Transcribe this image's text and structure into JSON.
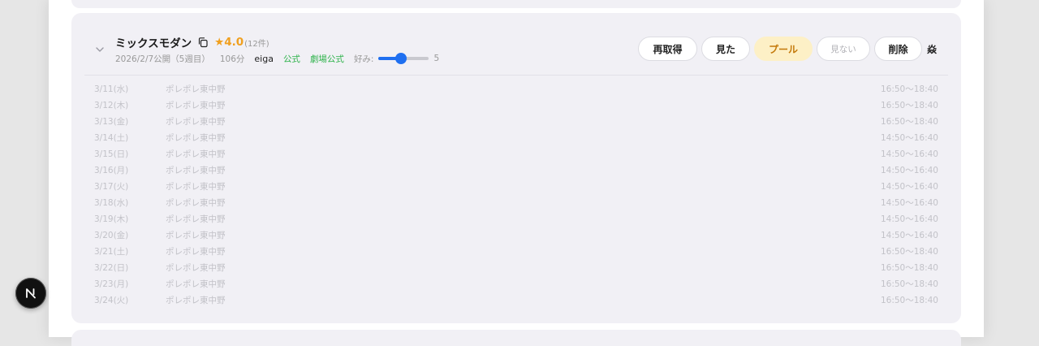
{
  "movie": {
    "title": "ミックスモダン",
    "rating": "★4.0",
    "rating_count": "(12件)",
    "release": "2026/2/7公開（5週目）",
    "runtime": "106分",
    "source": "eiga",
    "tag_official": "公式",
    "tag_theater_official": "劇場公式",
    "preference_label": "好み:",
    "preference_value": "5",
    "preference_fraction": 0.45
  },
  "actions": {
    "refetch": "再取得",
    "watched": "見た",
    "pool": "プール",
    "not_watching": "見ない",
    "delete": "削除",
    "overflow": "焱"
  },
  "showtimes": [
    {
      "date": "3/11(水)",
      "venue": "ポレポレ東中野",
      "time": "16:50〜18:40"
    },
    {
      "date": "3/12(木)",
      "venue": "ポレポレ東中野",
      "time": "16:50〜18:40"
    },
    {
      "date": "3/13(金)",
      "venue": "ポレポレ東中野",
      "time": "16:50〜18:40"
    },
    {
      "date": "3/14(土)",
      "venue": "ポレポレ東中野",
      "time": "14:50〜16:40"
    },
    {
      "date": "3/15(日)",
      "venue": "ポレポレ東中野",
      "time": "14:50〜16:40"
    },
    {
      "date": "3/16(月)",
      "venue": "ポレポレ東中野",
      "time": "14:50〜16:40"
    },
    {
      "date": "3/17(火)",
      "venue": "ポレポレ東中野",
      "time": "14:50〜16:40"
    },
    {
      "date": "3/18(水)",
      "venue": "ポレポレ東中野",
      "time": "14:50〜16:40"
    },
    {
      "date": "3/19(木)",
      "venue": "ポレポレ東中野",
      "time": "14:50〜16:40"
    },
    {
      "date": "3/20(金)",
      "venue": "ポレポレ東中野",
      "time": "14:50〜16:40"
    },
    {
      "date": "3/21(土)",
      "venue": "ポレポレ東中野",
      "time": "16:50〜18:40"
    },
    {
      "date": "3/22(日)",
      "venue": "ポレポレ東中野",
      "time": "16:50〜18:40"
    },
    {
      "date": "3/23(月)",
      "venue": "ポレポレ東中野",
      "time": "16:50〜18:40"
    },
    {
      "date": "3/24(火)",
      "venue": "ポレポレ東中野",
      "time": "16:50〜18:40"
    }
  ],
  "badge": {
    "letter": "N"
  },
  "icons": {
    "expand": "chevron-down-icon",
    "copy": "copy-icon",
    "badge": "next-logo-icon"
  },
  "colors": {
    "rating": "#f0a020",
    "tag_green": "#2fb34c",
    "slider": "#1f6ff0",
    "pool_bg": "#fdf0c6",
    "pool_text": "#c47a0b",
    "card_bg": "#f1f0f5"
  }
}
